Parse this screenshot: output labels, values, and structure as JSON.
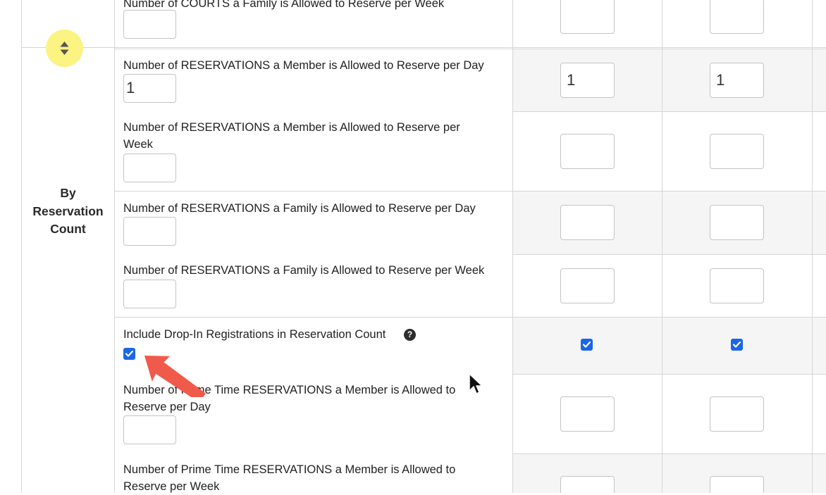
{
  "section": {
    "title_line1": "By",
    "title_line2": "Reservation",
    "title_line3": "Count"
  },
  "rows": {
    "courts_family_week": {
      "label": "Number of COURTS a Family is Allowed to Reserve per Week",
      "value": "",
      "col1": "",
      "col2": ""
    },
    "res_member_day": {
      "label": "Number of RESERVATIONS a Member is Allowed to Reserve per Day",
      "value": "1",
      "col1": "1",
      "col2": "1"
    },
    "res_member_week": {
      "label": "Number of RESERVATIONS a Member is Allowed to Reserve per Week",
      "value": "",
      "col1": "",
      "col2": ""
    },
    "res_family_day": {
      "label": "Number of RESERVATIONS a Family is Allowed to Reserve per Day",
      "value": "",
      "col1": "",
      "col2": ""
    },
    "res_family_week": {
      "label": "Number of RESERVATIONS a Family is Allowed to Reserve per Week",
      "value": "",
      "col1": "",
      "col2": ""
    },
    "include_dropin": {
      "label": "Include Drop-In Registrations in Reservation Count",
      "checked": true,
      "col1_checked": true,
      "col2_checked": true
    },
    "prime_member_day": {
      "label": "Number of Prime Time RESERVATIONS a Member is Allowed to Reserve per Day",
      "value": "",
      "col1": "",
      "col2": ""
    },
    "prime_member_week": {
      "label": "Number of Prime Time RESERVATIONS a Member is Allowed to Reserve per Week",
      "value": "",
      "col1": "",
      "col2": ""
    }
  },
  "icons": {
    "sort": "sort-up-down-icon",
    "help": "question-circle-icon",
    "annotation": "red-arrow-annotation",
    "cursor": "mouse-cursor-icon"
  },
  "colors": {
    "checkbox": "#1a66e8",
    "highlight": "#fbf382",
    "arrow": "#f05a4a",
    "cell_bg": "#f5f5f5",
    "border": "#d6d6d6"
  }
}
